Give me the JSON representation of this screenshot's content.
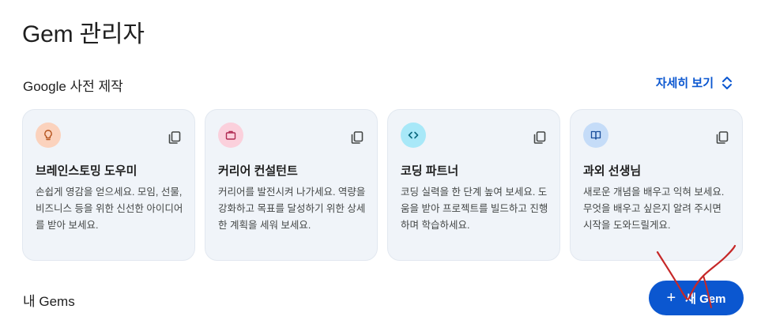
{
  "header": {
    "title": "Gem 관리자"
  },
  "premade": {
    "section_title": "Google 사전 제작",
    "more_label": "자세히 보기"
  },
  "cards": [
    {
      "title": "브레인스토밍 도우미",
      "desc": "손쉽게 영감을 얻으세요. 모임, 선물, 비즈니스 등을 위한 신선한 아이디어를 받아 보세요.",
      "icon": "lightbulb-icon",
      "icon_bg": "#fbd2bd",
      "icon_color": "#b5541e"
    },
    {
      "title": "커리어 컨설턴트",
      "desc": "커리어를 발전시켜 나가세요. 역량을 강화하고 목표를 달성하기 위한 상세한 계획을 세워 보세요.",
      "icon": "briefcase-icon",
      "icon_bg": "#fbd0dc",
      "icon_color": "#b02a52"
    },
    {
      "title": "코딩 파트너",
      "desc": "코딩 실력을 한 단계 높여 보세요. 도움을 받아 프로젝트를 빌드하고 진행하며 학습하세요.",
      "icon": "code-icon",
      "icon_bg": "#a8e8f8",
      "icon_color": "#0b6a80"
    },
    {
      "title": "과외 선생님",
      "desc": "새로운 개념을 배우고 익혀 보세요. 무엇을 배우고 싶은지 알려 주시면 시작을 도와드릴게요.",
      "icon": "book-icon",
      "icon_bg": "#c5dcf8",
      "icon_color": "#1b4f9c"
    }
  ],
  "my_gems": {
    "section_title": "내 Gems",
    "new_button_label": "새 Gem",
    "new_button_icon": "plus-icon"
  },
  "colors": {
    "accent": "#0b57d0",
    "card_bg": "#f0f4f9",
    "annotation": "#c62828"
  }
}
